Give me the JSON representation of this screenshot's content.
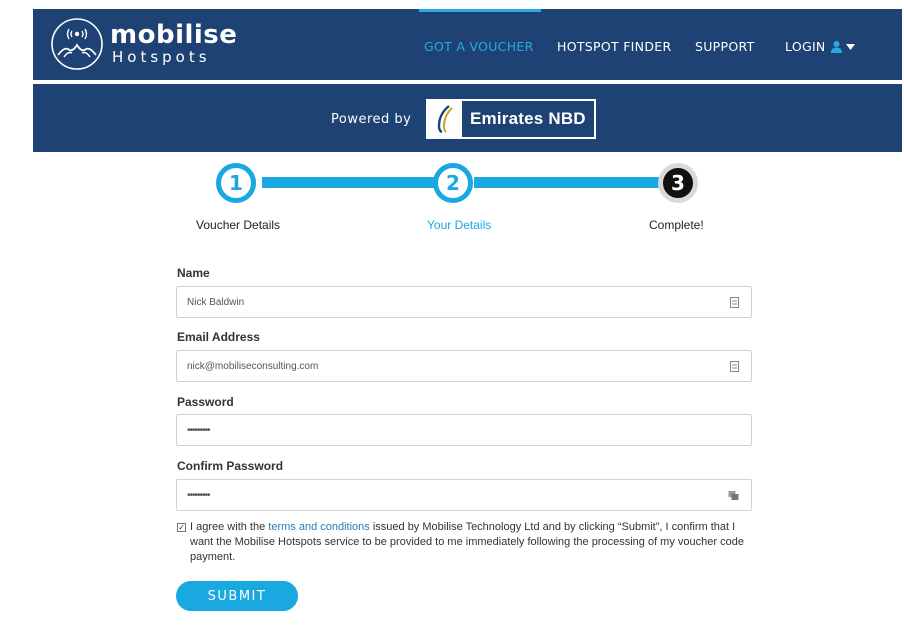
{
  "header": {
    "logo_main": "mobilise",
    "logo_sub": "Hotspots",
    "nav": {
      "voucher": "GOT A VOUCHER",
      "hotspot": "HOTSPOT FINDER",
      "support": "SUPPORT",
      "login": "LOGIN"
    },
    "powered_by": "Powered by",
    "sponsor": "Emirates NBD"
  },
  "steps": [
    {
      "number": "1",
      "label": "Voucher Details"
    },
    {
      "number": "2",
      "label": "Your Details"
    },
    {
      "number": "3",
      "label": "Complete!"
    }
  ],
  "form": {
    "name": {
      "label": "Name",
      "value": "Nick Baldwin"
    },
    "email": {
      "label": "Email Address",
      "value": "nick@mobiliseconsulting.com"
    },
    "password": {
      "label": "Password",
      "value": "•••••••••"
    },
    "confirm": {
      "label": "Confirm Password",
      "value": "•••••••••"
    },
    "agree": {
      "checked": true,
      "text_before": "I agree with the ",
      "link": "terms and conditions",
      "text_after": " issued by Mobilise Technology Ltd and by clicking “Submit”, I confirm that I want the Mobilise Hotspots service to be provided to me immediately following the processing of my voucher code payment."
    },
    "submit": "SUBMIT"
  },
  "colors": {
    "header_bg": "#1d4273",
    "accent": "#1aa8e1",
    "step_complete": "#111111"
  }
}
